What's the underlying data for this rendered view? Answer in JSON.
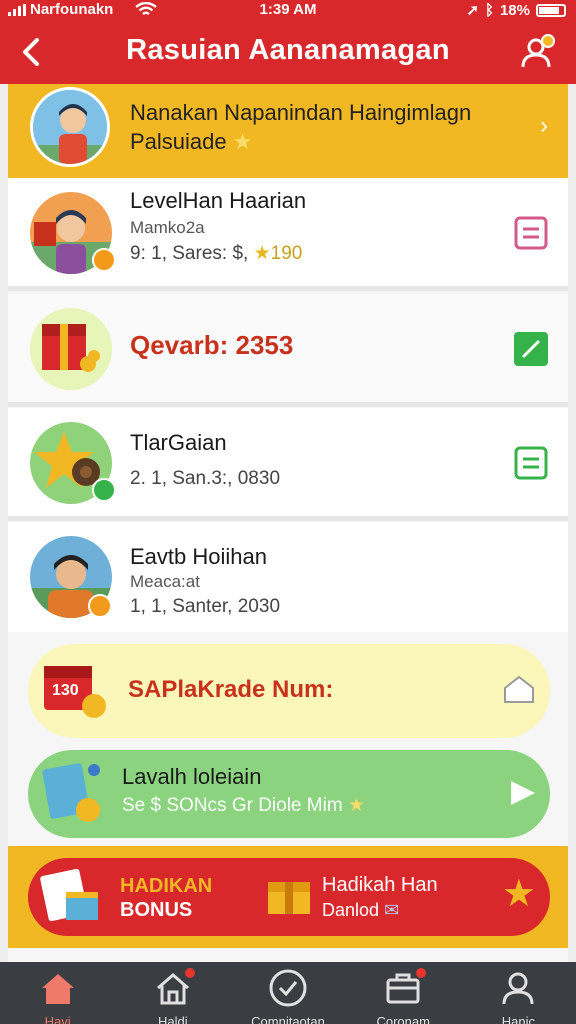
{
  "status_bar": {
    "carrier": "Narfounakn",
    "time": "1:39 AM",
    "battery": "18%"
  },
  "header": {
    "title": "Rasuian Aananamagan"
  },
  "banner": {
    "line1": "Nanakan Napanindan Haingimlagn",
    "line2": "Palsuiade"
  },
  "rows": [
    {
      "name": "LevelHan Haarian",
      "sub": "Mamko2a",
      "meta": "9: 1, Sares: $,",
      "points": "190"
    },
    {
      "promo": "Qevarb: 2353"
    },
    {
      "name": "TlarGaian",
      "meta": "2. 1, San.3:, 0830"
    },
    {
      "name": "Eavtb Hoiihan",
      "sub": "Meaca:at",
      "meta": "1, 1, Santer, 2030"
    }
  ],
  "promo_pill": {
    "text": "SAPlaKrade Num:",
    "icon_text": "130"
  },
  "green_pill": {
    "line1": "Lavalh loleiain",
    "line2": "Se $ SONcs Gr Diole Mim"
  },
  "bonus": {
    "title1": "HADIKAN",
    "title2": "BONUS",
    "right1": "Hadikah Han",
    "right2": "Danlod"
  },
  "tabs": [
    {
      "label": "Havi"
    },
    {
      "label": "Haldi"
    },
    {
      "label": "Comnitaotan"
    },
    {
      "label": "Coronam"
    },
    {
      "label": "Hanic"
    }
  ],
  "colors": {
    "primary_red": "#d8282b",
    "accent_yellow": "#f2b824",
    "green": "#8bd37f",
    "tab_bg": "#3a3d42"
  }
}
